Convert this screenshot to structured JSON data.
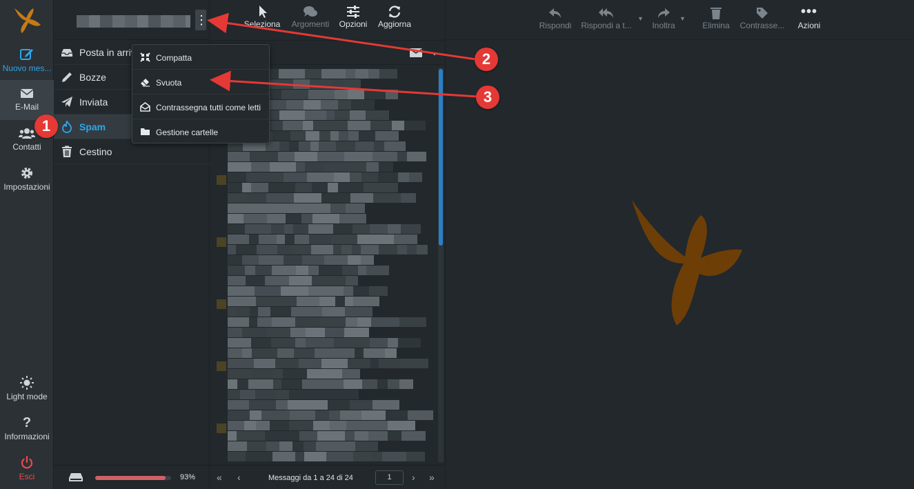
{
  "taskbar": {
    "new_message": "Nuovo mes...",
    "email": "E-Mail",
    "contacts": "Contatti",
    "settings": "Impostazioni",
    "light_mode": "Light mode",
    "info": "Informazioni",
    "exit": "Esci"
  },
  "folders": [
    {
      "label": "Posta in arrivo",
      "icon": "inbox-icon"
    },
    {
      "label": "Bozze",
      "icon": "pencil-icon"
    },
    {
      "label": "Inviata",
      "icon": "paper-plane-icon"
    },
    {
      "label": "Spam",
      "icon": "fire-icon"
    },
    {
      "label": "Cestino",
      "icon": "trash-icon"
    }
  ],
  "quota": {
    "percent": "93%",
    "fraction": 0.93
  },
  "list_toolbar": {
    "select": "Seleziona",
    "threads": "Argomenti",
    "options": "Opzioni",
    "refresh": "Aggiorna"
  },
  "context_menu": [
    {
      "label": "Compatta",
      "icon": "compress-icon"
    },
    {
      "label": "Svuota",
      "icon": "eraser-icon"
    },
    {
      "label": "Contrassegna tutti come letti",
      "icon": "envelope-open-icon"
    },
    {
      "label": "Gestione cartelle",
      "icon": "folder-icon"
    }
  ],
  "pager": {
    "info": "Messaggi da 1 a 24 di 24",
    "page": "1"
  },
  "preview_toolbar": {
    "reply": "Rispondi",
    "reply_all": "Rispondi a t...",
    "forward": "Inoltra",
    "delete": "Elimina",
    "mark": "Contrasse...",
    "actions": "Azioni"
  },
  "annotations": {
    "one": "1",
    "two": "2",
    "three": "3"
  },
  "colors": {
    "accent": "#2ea6ea",
    "brand": "#c57a14",
    "danger": "#ea4b4b",
    "annotation": "#e53935"
  }
}
